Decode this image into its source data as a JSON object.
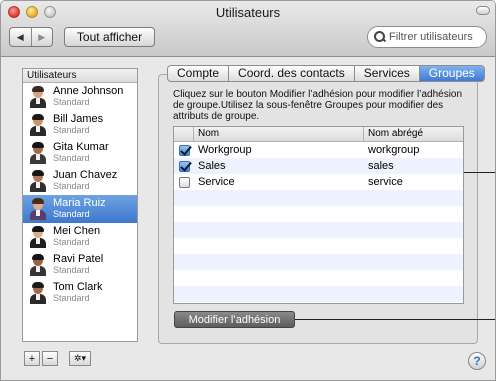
{
  "window": {
    "title": "Utilisateurs"
  },
  "toolbar": {
    "back_label": "◀",
    "forward_label": "▶",
    "show_all_label": "Tout afficher",
    "search_placeholder": "Filtrer utilisateurs"
  },
  "sidebar": {
    "header": "Utilisateurs",
    "users": [
      {
        "name": "Anne Johnson",
        "role": "Standard"
      },
      {
        "name": "Bill James",
        "role": "Standard"
      },
      {
        "name": "Gita Kumar",
        "role": "Standard"
      },
      {
        "name": "Juan Chavez",
        "role": "Standard"
      },
      {
        "name": "Maria Ruiz",
        "role": "Standard"
      },
      {
        "name": "Mei Chen",
        "role": "Standard"
      },
      {
        "name": "Ravi Patel",
        "role": "Standard"
      },
      {
        "name": "Tom Clark",
        "role": "Standard"
      }
    ],
    "selected_user": "Maria Ruiz",
    "add_label": "+",
    "remove_label": "−",
    "action_label": "✲▾"
  },
  "tabs": {
    "items": [
      {
        "label": "Compte"
      },
      {
        "label": "Coord. des contacts"
      },
      {
        "label": "Services"
      },
      {
        "label": "Groupes"
      }
    ],
    "active": "Groupes"
  },
  "groups": {
    "instructions": "Cliquez sur le bouton Modifier l’adhésion pour modifier l’adhésion de groupe.Utilisez la sous-fenêtre Groupes pour modifier des attributs de groupe.",
    "columns": {
      "name": "Nom",
      "short": "Nom abrégé"
    },
    "rows": [
      {
        "checked": true,
        "name": "Workgroup",
        "short": "workgroup"
      },
      {
        "checked": true,
        "name": "Sales",
        "short": "sales"
      },
      {
        "checked": false,
        "name": "Service",
        "short": "service"
      }
    ],
    "modify_button_label": "Modifier l’adhésion"
  },
  "footer": {
    "help_label": "?"
  }
}
